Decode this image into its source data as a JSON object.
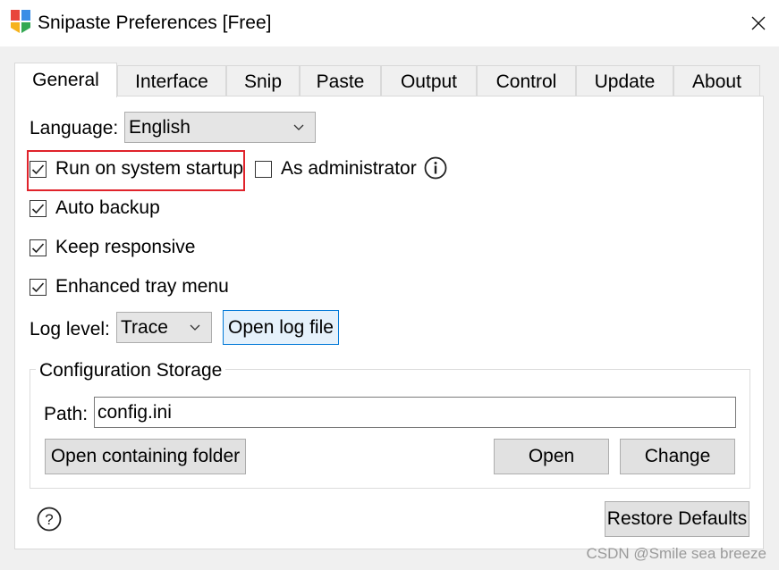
{
  "window": {
    "title": "Snipaste Preferences [Free]",
    "app_icon": "snipaste-logo-icon",
    "close_icon": "close-icon"
  },
  "tabs": [
    {
      "label": "General",
      "active": true
    },
    {
      "label": "Interface",
      "active": false
    },
    {
      "label": "Snip",
      "active": false
    },
    {
      "label": "Paste",
      "active": false
    },
    {
      "label": "Output",
      "active": false
    },
    {
      "label": "Control",
      "active": false
    },
    {
      "label": "Update",
      "active": false
    },
    {
      "label": "About",
      "active": false
    }
  ],
  "general": {
    "language_label": "Language:",
    "language_value": "English",
    "run_on_startup": {
      "label": "Run on system startup",
      "checked": true
    },
    "as_administrator": {
      "label": "As administrator",
      "checked": false
    },
    "auto_backup": {
      "label": "Auto backup",
      "checked": true
    },
    "keep_responsive": {
      "label": "Keep responsive",
      "checked": true
    },
    "enhanced_tray_menu": {
      "label": "Enhanced tray menu",
      "checked": true
    },
    "log_level_label": "Log level:",
    "log_level_value": "Trace",
    "open_log_file": "Open log file",
    "config_storage": {
      "title": "Configuration Storage",
      "path_label": "Path:",
      "path_value": "config.ini",
      "open_containing_folder": "Open containing folder",
      "open": "Open",
      "change": "Change"
    },
    "restore_defaults": "Restore Defaults"
  },
  "colors": {
    "highlight": "#e0232b",
    "focus_border": "#0078d7",
    "logo": [
      "#e8463b",
      "#f6b21b",
      "#3a8ee6",
      "#34a853"
    ]
  },
  "watermark": "CSDN @Smile sea breeze"
}
